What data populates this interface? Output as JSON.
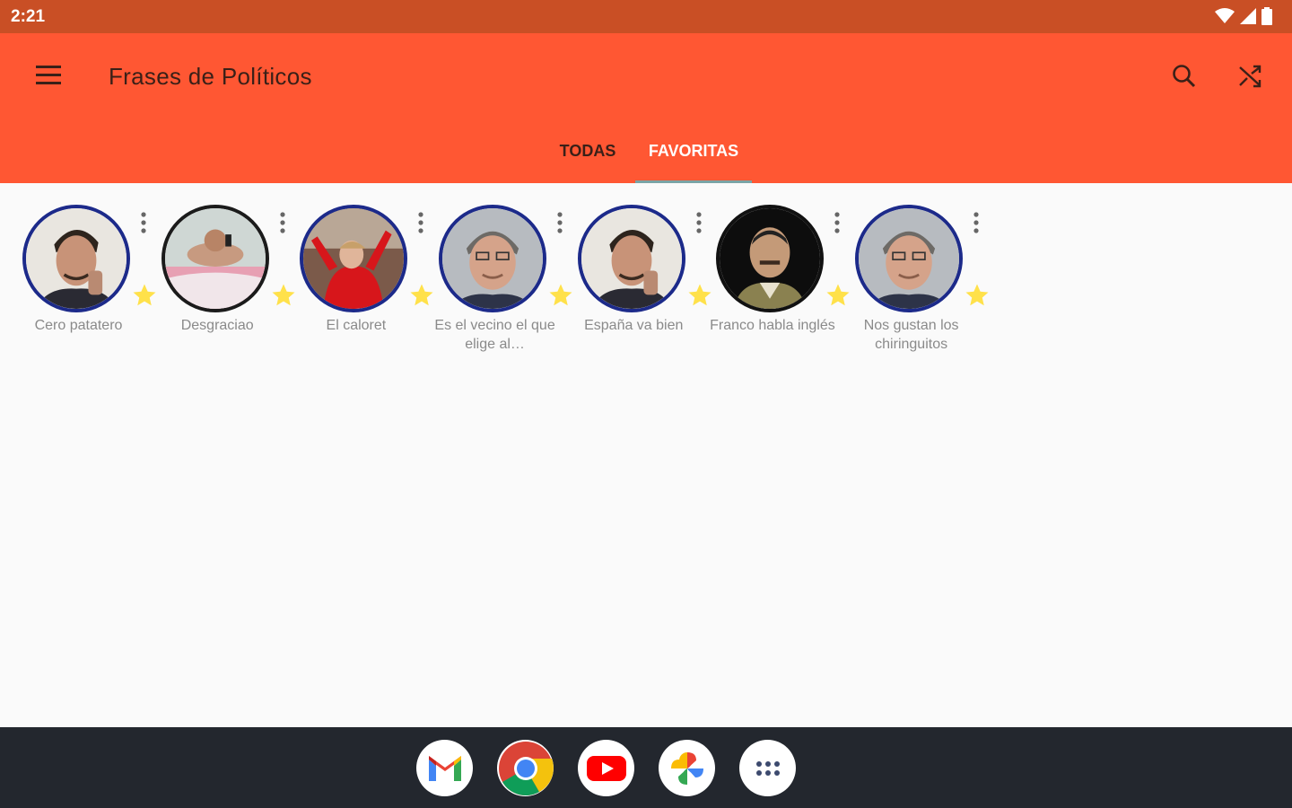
{
  "status_bar": {
    "time": "2:21",
    "icons": [
      "wifi-icon",
      "signal-icon",
      "battery-icon"
    ]
  },
  "app_bar": {
    "title": "Frases de Políticos",
    "background": "#ff5733",
    "actions": [
      "search-icon",
      "shuffle-icon"
    ]
  },
  "tabs": [
    {
      "label": "TODAS",
      "selected": false
    },
    {
      "label": "FAVORITAS",
      "selected": true
    }
  ],
  "phrases": [
    {
      "label": "Cero patatero",
      "favorite": true
    },
    {
      "label": "Desgraciao",
      "favorite": true
    },
    {
      "label": "El caloret",
      "favorite": true
    },
    {
      "label": "Es el vecino el que elige al…",
      "favorite": true
    },
    {
      "label": "España va bien",
      "favorite": true
    },
    {
      "label": "Franco habla inglés",
      "favorite": true
    },
    {
      "label": "Nos gustan los chiringuitos",
      "favorite": true
    }
  ],
  "dock": {
    "apps": [
      "gmail-icon",
      "chrome-icon",
      "youtube-icon",
      "photos-icon",
      "app-drawer-icon"
    ]
  },
  "colors": {
    "status_bar": "#c94f25",
    "accent": "#ff5733",
    "avatar_ring": "#1c2a8a",
    "star": "#ffe14a",
    "tab_indicator": "#7aa4a6"
  }
}
